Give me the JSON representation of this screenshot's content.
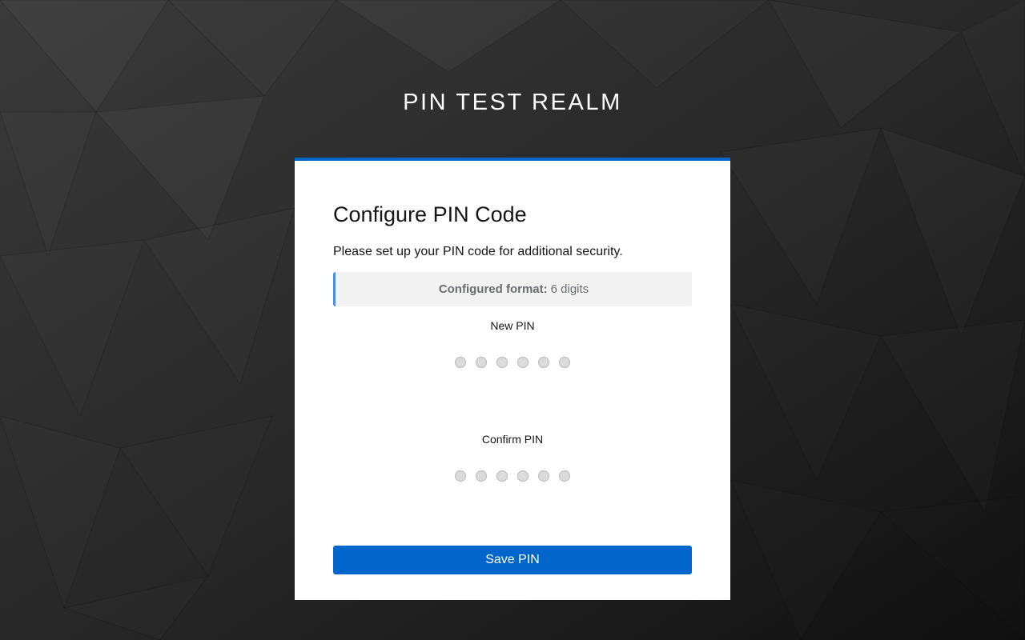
{
  "realm": {
    "title": "PIN TEST REALM"
  },
  "card": {
    "accent_color": "#0066cc",
    "title": "Configure PIN Code",
    "description": "Please set up your PIN code for additional security.",
    "format_alert": {
      "label": "Configured format:",
      "value": "6 digits"
    },
    "new_pin": {
      "label": "New PIN",
      "digits": [
        "",
        "",
        "",
        "",
        "",
        ""
      ]
    },
    "confirm_pin": {
      "label": "Confirm PIN",
      "digits": [
        "",
        "",
        "",
        "",
        "",
        ""
      ]
    },
    "save_button": {
      "label": "Save PIN"
    }
  }
}
